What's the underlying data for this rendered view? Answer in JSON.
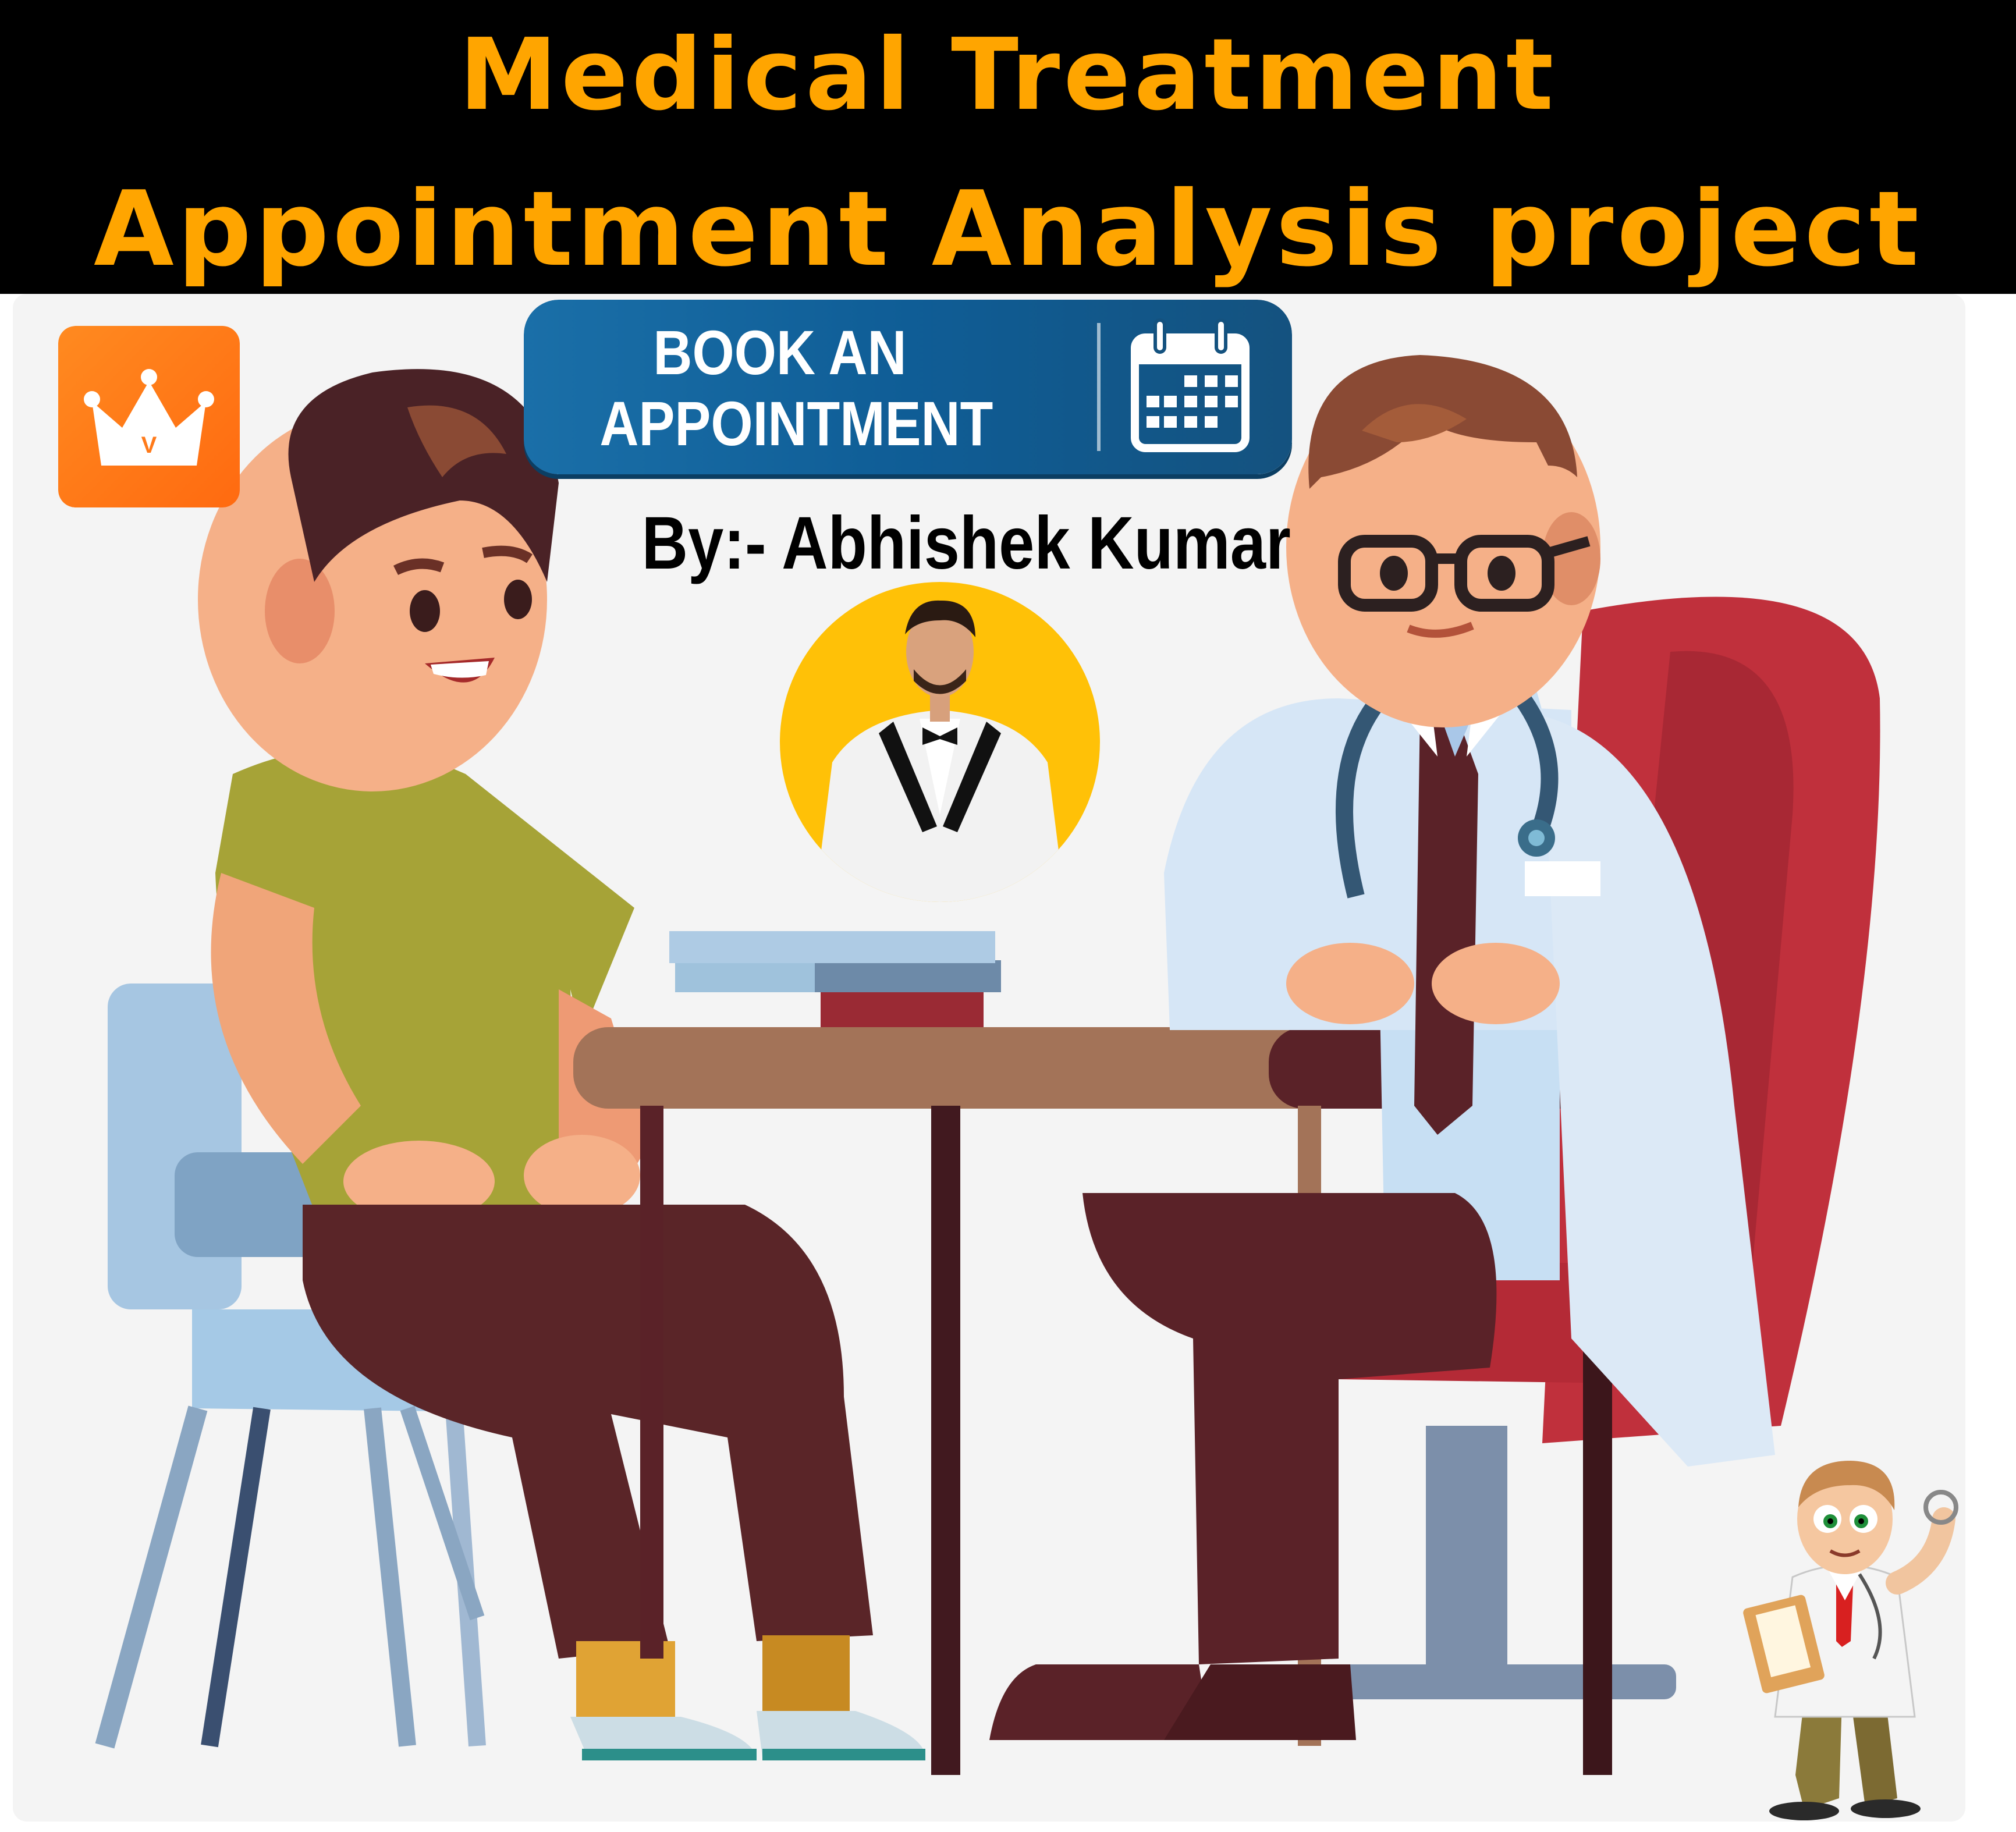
{
  "header": {
    "title_line_1": "Medical Treatment",
    "title_line_2": "Appointment Analysis project",
    "text_color": "#ffa500",
    "background": "#000000"
  },
  "cta": {
    "label": "BOOK AN\nAPPOINTMENT",
    "icon": "calendar-icon",
    "color": "#0e5a8f"
  },
  "author": {
    "byline": "By:- Abhishek Kumar",
    "avatar_background": "#ffc107"
  },
  "badge": {
    "icon": "crown-icon",
    "letter": "V",
    "color": "#ff7a1a"
  },
  "illustration": {
    "patient_shirt": "#a6a337",
    "doctor_coat": "#d6e6f6",
    "chair_red": "#c0303c",
    "desk_top": "#a37358"
  }
}
